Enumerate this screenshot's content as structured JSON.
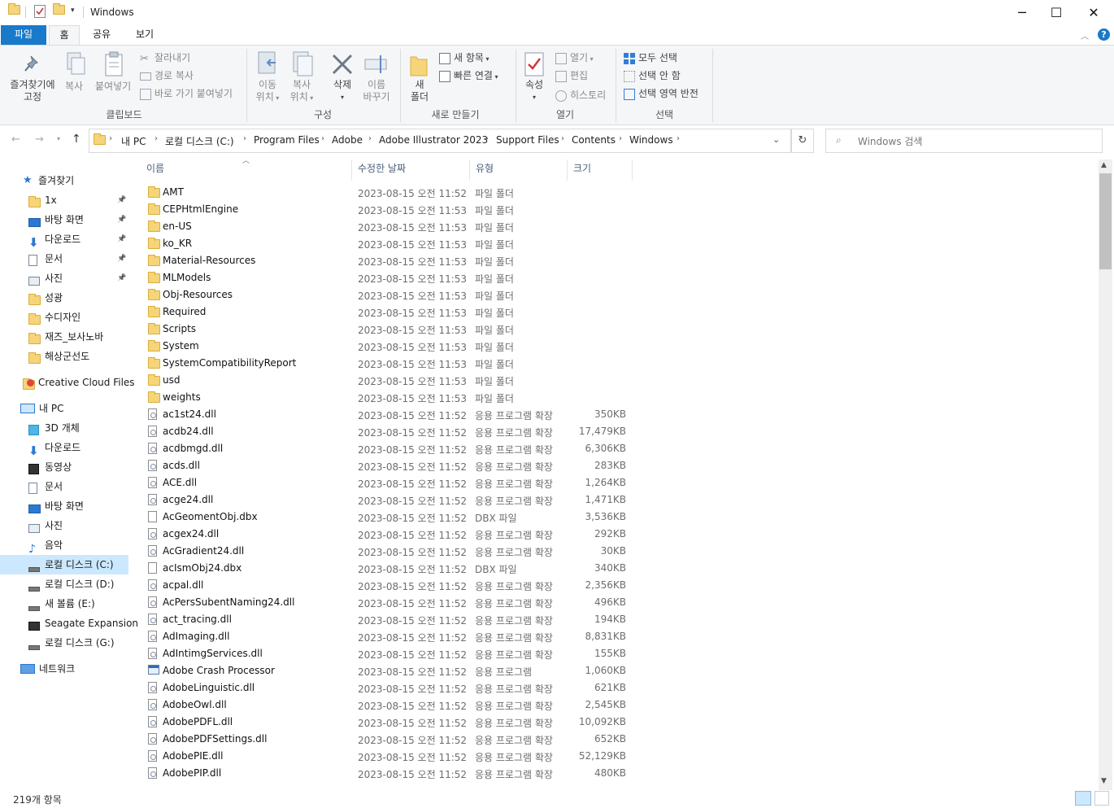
{
  "window": {
    "title": "Windows",
    "controls": {
      "minimize": "─",
      "maximize": "☐",
      "close": "✕"
    }
  },
  "tabs": {
    "file": "파일",
    "home": "홈",
    "share": "공유",
    "view": "보기"
  },
  "ribbon": {
    "pin": "즐겨찾기에\n고정",
    "pin_l1": "즐겨찾기에",
    "pin_l2": "고정",
    "copy": "복사",
    "paste": "붙여넣기",
    "cut": "잘라내기",
    "copy_path": "경로 복사",
    "paste_shortcut": "바로 가기 붙여넣기",
    "clipboard_group": "클립보드",
    "move_to_l1": "이동",
    "move_to_l2": "위치",
    "copy_to_l1": "복사",
    "copy_to_l2": "위치",
    "delete": "삭제",
    "rename_l1": "이름",
    "rename_l2": "바꾸기",
    "organize_group": "구성",
    "new_folder_l1": "새",
    "new_folder_l2": "폴더",
    "new_item": "새 항목",
    "easy_access": "빠른 연결",
    "new_group": "새로 만들기",
    "properties": "속성",
    "open": "열기",
    "edit": "편집",
    "history": "히스토리",
    "open_group": "열기",
    "select_all": "모두 선택",
    "select_none": "선택 안 함",
    "invert_selection": "선택 영역 반전",
    "select_group": "선택"
  },
  "address": {
    "crumbs": [
      "내 PC",
      "로컬 디스크 (C:)",
      "Program Files",
      "Adobe",
      "Adobe Illustrator 2023",
      "Support Files",
      "Contents",
      "Windows"
    ]
  },
  "search": {
    "placeholder": "Windows 검색"
  },
  "sidebar": {
    "quick_access": "즐겨찾기",
    "items": [
      {
        "label": "1x",
        "pinned": true,
        "icon": "folder-icon"
      },
      {
        "label": "바탕 화면",
        "pinned": true,
        "icon": "desktop-icon"
      },
      {
        "label": "다운로드",
        "pinned": true,
        "icon": "download-icon"
      },
      {
        "label": "문서",
        "pinned": true,
        "icon": "document-icon"
      },
      {
        "label": "사진",
        "pinned": true,
        "icon": "pictures-icon"
      },
      {
        "label": "성광",
        "pinned": false,
        "icon": "folder-icon"
      },
      {
        "label": "수디자인",
        "pinned": false,
        "icon": "folder-icon"
      },
      {
        "label": "재즈_보사노바",
        "pinned": false,
        "icon": "folder-icon"
      },
      {
        "label": "해상군선도",
        "pinned": false,
        "icon": "folder-icon"
      }
    ],
    "creative_cloud": "Creative Cloud Files",
    "this_pc": "내 PC",
    "pc_items": [
      {
        "label": "3D 개체",
        "icon": "3d-objects-icon"
      },
      {
        "label": "다운로드",
        "icon": "download-icon"
      },
      {
        "label": "동영상",
        "icon": "video-icon"
      },
      {
        "label": "문서",
        "icon": "document-icon"
      },
      {
        "label": "바탕 화면",
        "icon": "desktop-icon"
      },
      {
        "label": "사진",
        "icon": "pictures-icon"
      },
      {
        "label": "음악",
        "icon": "music-icon"
      },
      {
        "label": "로컬 디스크 (C:)",
        "icon": "drive-icon",
        "selected": true
      },
      {
        "label": "로컬 디스크 (D:)",
        "icon": "drive-icon"
      },
      {
        "label": "새 볼륨 (E:)",
        "icon": "drive-icon"
      },
      {
        "label": "Seagate Expansion",
        "icon": "external-drive-icon"
      },
      {
        "label": "로컬 디스크 (G:)",
        "icon": "drive-icon"
      }
    ],
    "network": "네트워크"
  },
  "columns": {
    "name": "이름",
    "modified": "수정한 날짜",
    "type": "유형",
    "size": "크기"
  },
  "files": [
    {
      "name": "AMT",
      "date": "2023-08-15 오전 11:52",
      "type": "파일 폴더",
      "size": "",
      "kind": "folder"
    },
    {
      "name": "CEPHtmlEngine",
      "date": "2023-08-15 오전 11:53",
      "type": "파일 폴더",
      "size": "",
      "kind": "folder"
    },
    {
      "name": "en-US",
      "date": "2023-08-15 오전 11:53",
      "type": "파일 폴더",
      "size": "",
      "kind": "folder"
    },
    {
      "name": "ko_KR",
      "date": "2023-08-15 오전 11:53",
      "type": "파일 폴더",
      "size": "",
      "kind": "folder"
    },
    {
      "name": "Material-Resources",
      "date": "2023-08-15 오전 11:53",
      "type": "파일 폴더",
      "size": "",
      "kind": "folder"
    },
    {
      "name": "MLModels",
      "date": "2023-08-15 오전 11:53",
      "type": "파일 폴더",
      "size": "",
      "kind": "folder"
    },
    {
      "name": "Obj-Resources",
      "date": "2023-08-15 오전 11:53",
      "type": "파일 폴더",
      "size": "",
      "kind": "folder"
    },
    {
      "name": "Required",
      "date": "2023-08-15 오전 11:53",
      "type": "파일 폴더",
      "size": "",
      "kind": "folder"
    },
    {
      "name": "Scripts",
      "date": "2023-08-15 오전 11:53",
      "type": "파일 폴더",
      "size": "",
      "kind": "folder"
    },
    {
      "name": "System",
      "date": "2023-08-15 오전 11:53",
      "type": "파일 폴더",
      "size": "",
      "kind": "folder"
    },
    {
      "name": "SystemCompatibilityReport",
      "date": "2023-08-15 오전 11:53",
      "type": "파일 폴더",
      "size": "",
      "kind": "folder"
    },
    {
      "name": "usd",
      "date": "2023-08-15 오전 11:53",
      "type": "파일 폴더",
      "size": "",
      "kind": "folder"
    },
    {
      "name": "weights",
      "date": "2023-08-15 오전 11:53",
      "type": "파일 폴더",
      "size": "",
      "kind": "folder"
    },
    {
      "name": "ac1st24.dll",
      "date": "2023-08-15 오전 11:52",
      "type": "응용 프로그램 확장",
      "size": "350KB",
      "kind": "dll"
    },
    {
      "name": "acdb24.dll",
      "date": "2023-08-15 오전 11:52",
      "type": "응용 프로그램 확장",
      "size": "17,479KB",
      "kind": "dll"
    },
    {
      "name": "acdbmgd.dll",
      "date": "2023-08-15 오전 11:52",
      "type": "응용 프로그램 확장",
      "size": "6,306KB",
      "kind": "dll"
    },
    {
      "name": "acds.dll",
      "date": "2023-08-15 오전 11:52",
      "type": "응용 프로그램 확장",
      "size": "283KB",
      "kind": "dll"
    },
    {
      "name": "ACE.dll",
      "date": "2023-08-15 오전 11:52",
      "type": "응용 프로그램 확장",
      "size": "1,264KB",
      "kind": "dll"
    },
    {
      "name": "acge24.dll",
      "date": "2023-08-15 오전 11:52",
      "type": "응용 프로그램 확장",
      "size": "1,471KB",
      "kind": "dll"
    },
    {
      "name": "AcGeomentObj.dbx",
      "date": "2023-08-15 오전 11:52",
      "type": "DBX 파일",
      "size": "3,536KB",
      "kind": "file"
    },
    {
      "name": "acgex24.dll",
      "date": "2023-08-15 오전 11:52",
      "type": "응용 프로그램 확장",
      "size": "292KB",
      "kind": "dll"
    },
    {
      "name": "AcGradient24.dll",
      "date": "2023-08-15 오전 11:52",
      "type": "응용 프로그램 확장",
      "size": "30KB",
      "kind": "dll"
    },
    {
      "name": "acIsmObj24.dbx",
      "date": "2023-08-15 오전 11:52",
      "type": "DBX 파일",
      "size": "340KB",
      "kind": "file"
    },
    {
      "name": "acpal.dll",
      "date": "2023-08-15 오전 11:52",
      "type": "응용 프로그램 확장",
      "size": "2,356KB",
      "kind": "dll"
    },
    {
      "name": "AcPersSubentNaming24.dll",
      "date": "2023-08-15 오전 11:52",
      "type": "응용 프로그램 확장",
      "size": "496KB",
      "kind": "dll"
    },
    {
      "name": "act_tracing.dll",
      "date": "2023-08-15 오전 11:52",
      "type": "응용 프로그램 확장",
      "size": "194KB",
      "kind": "dll"
    },
    {
      "name": "AdImaging.dll",
      "date": "2023-08-15 오전 11:52",
      "type": "응용 프로그램 확장",
      "size": "8,831KB",
      "kind": "dll"
    },
    {
      "name": "AdIntimgServices.dll",
      "date": "2023-08-15 오전 11:52",
      "type": "응용 프로그램 확장",
      "size": "155KB",
      "kind": "dll"
    },
    {
      "name": "Adobe Crash Processor",
      "date": "2023-08-15 오전 11:52",
      "type": "응용 프로그램",
      "size": "1,060KB",
      "kind": "app"
    },
    {
      "name": "AdobeLinguistic.dll",
      "date": "2023-08-15 오전 11:52",
      "type": "응용 프로그램 확장",
      "size": "621KB",
      "kind": "dll"
    },
    {
      "name": "AdobeOwl.dll",
      "date": "2023-08-15 오전 11:52",
      "type": "응용 프로그램 확장",
      "size": "2,545KB",
      "kind": "dll"
    },
    {
      "name": "AdobePDFL.dll",
      "date": "2023-08-15 오전 11:52",
      "type": "응용 프로그램 확장",
      "size": "10,092KB",
      "kind": "dll"
    },
    {
      "name": "AdobePDFSettings.dll",
      "date": "2023-08-15 오전 11:52",
      "type": "응용 프로그램 확장",
      "size": "652KB",
      "kind": "dll"
    },
    {
      "name": "AdobePIE.dll",
      "date": "2023-08-15 오전 11:52",
      "type": "응용 프로그램 확장",
      "size": "52,129KB",
      "kind": "dll"
    },
    {
      "name": "AdobePIP.dll",
      "date": "2023-08-15 오전 11:52",
      "type": "응용 프로그램 확장",
      "size": "480KB",
      "kind": "dll"
    }
  ],
  "status": {
    "count": "219개 항목"
  }
}
